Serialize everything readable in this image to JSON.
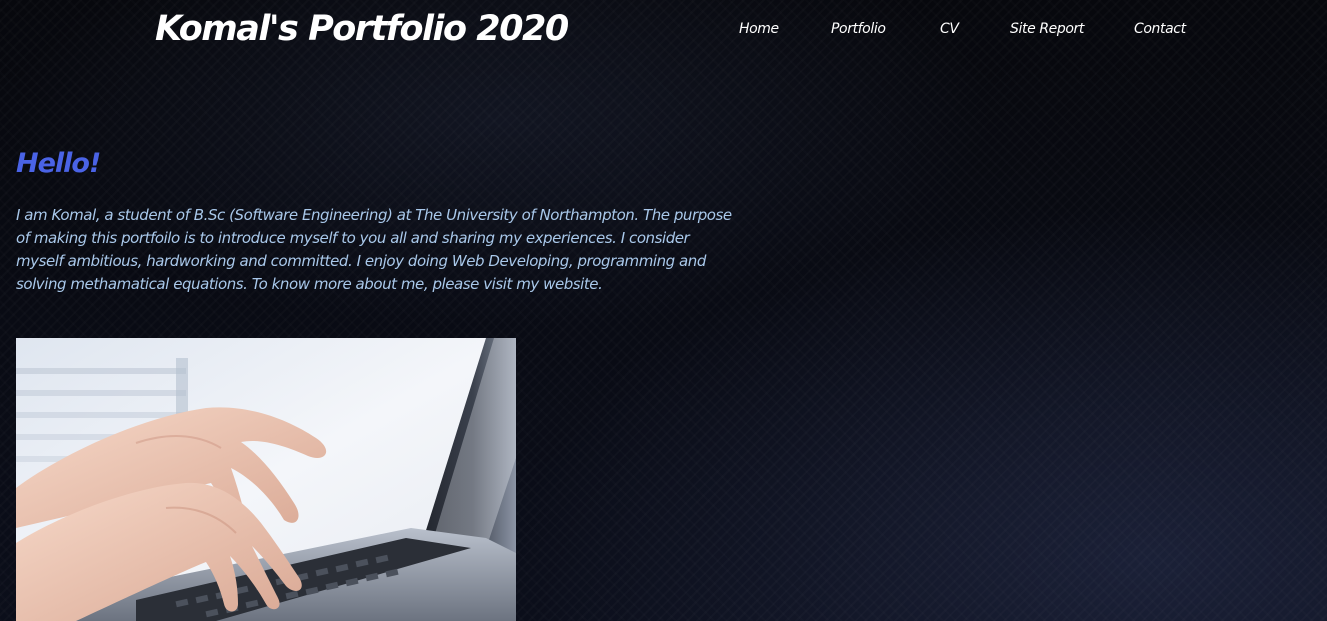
{
  "header": {
    "site_title": "Komal's Portfolio 2020"
  },
  "nav": {
    "items": [
      {
        "label": "Home"
      },
      {
        "label": "Portfolio"
      },
      {
        "label": "CV"
      },
      {
        "label": "Site Report"
      },
      {
        "label": "Contact"
      }
    ]
  },
  "main": {
    "greeting": "Hello!",
    "intro": "I am Komal, a student of B.Sc (Software Engineering) at The University of Northampton. The purpose of making this portfoilo is to introduce myself to you all and sharing my experiences. I consider myself ambitious, hardworking and committed. I enjoy doing Web Developing, programming and solving methamatical equations. To know more about me, please visit my website.",
    "image": {
      "subject": "hands typing on laptop keyboard"
    }
  },
  "colors": {
    "background": "#090b14",
    "greeting": "#4a63e6",
    "body_text": "#a9c8ea",
    "nav_text": "#ffffff"
  }
}
